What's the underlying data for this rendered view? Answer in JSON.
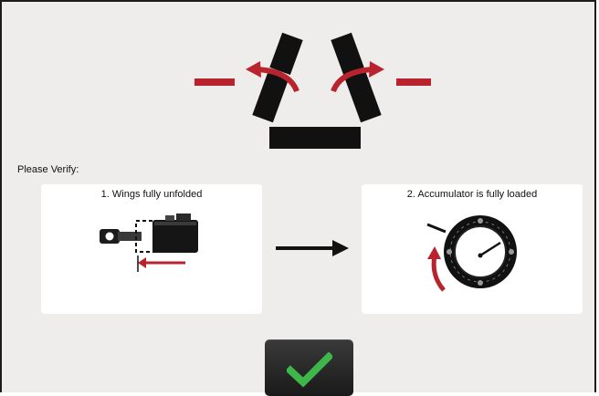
{
  "screen": {
    "verify_label": "Please Verify:",
    "colors": {
      "background": "#efedeb",
      "accent_red": "#b8232e",
      "panel_black": "#111111",
      "confirm_green": "#3fb649"
    }
  },
  "checks": [
    {
      "label": "1. Wings fully unfolded",
      "icon": "hydraulic-cylinder-icon"
    },
    {
      "label": "2. Accumulator is fully loaded",
      "icon": "pressure-gauge-icon"
    }
  ],
  "hero": {
    "icon": "wings-unfolding-icon"
  },
  "flow": {
    "icon": "arrow-right-icon"
  },
  "confirm": {
    "icon": "checkmark-icon",
    "label": ""
  }
}
